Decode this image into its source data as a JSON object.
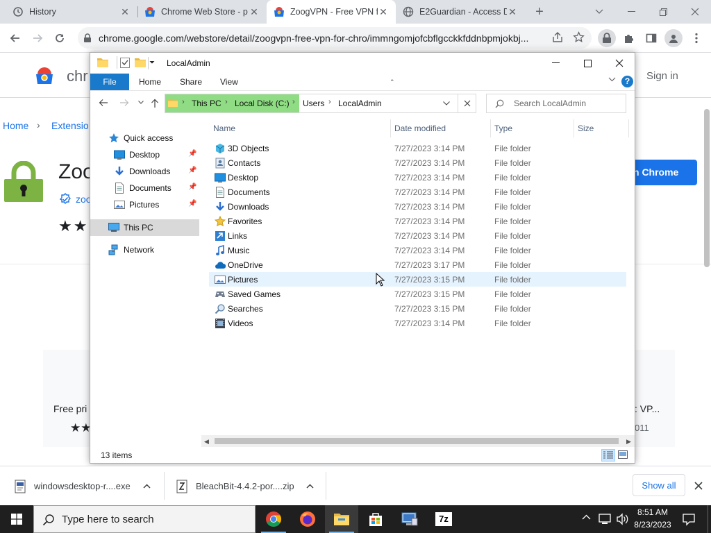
{
  "browser": {
    "tabs": [
      {
        "title": "History",
        "active": false
      },
      {
        "title": "Chrome Web Store - p",
        "active": false
      },
      {
        "title": "ZoogVPN - Free VPN f",
        "active": true
      },
      {
        "title": "E2Guardian - Access D",
        "active": false
      }
    ],
    "url": "chrome.google.com/webstore/detail/zoogvpn-free-vpn-for-chro/immngomjofcbflgcckkfddnbpmjokbj..."
  },
  "webpage": {
    "store_name": "chr",
    "sign_in": "Sign in",
    "breadcrumb_home": "Home",
    "breadcrumb_ext": "Extensio",
    "ext_title": "Zoo",
    "publisher": "zoo",
    "add_button": "n Chrome",
    "card_left_title": "Free pri",
    "card_right_title": ": VP...",
    "card_right_meta": "011",
    "colors": {
      "brand_blue": "#1a73e8",
      "lock_green": "#7cb342"
    }
  },
  "explorer": {
    "window_title": "LocalAdmin",
    "ribbon_tabs": [
      "File",
      "Home",
      "Share",
      "View"
    ],
    "breadcrumb": [
      "This PC",
      "Local Disk (C:)",
      "Users",
      "LocalAdmin"
    ],
    "search_placeholder": "Search LocalAdmin",
    "nav": {
      "quick_access": "Quick access",
      "pinned": [
        "Desktop",
        "Downloads",
        "Documents",
        "Pictures"
      ],
      "this_pc": "This PC",
      "network": "Network"
    },
    "columns": {
      "name": "Name",
      "date": "Date modified",
      "type": "Type",
      "size": "Size"
    },
    "files": [
      {
        "name": "3D Objects",
        "date": "7/27/2023 3:14 PM",
        "type": "File folder",
        "icon": "3d-objects-icon"
      },
      {
        "name": "Contacts",
        "date": "7/27/2023 3:14 PM",
        "type": "File folder",
        "icon": "contacts-icon"
      },
      {
        "name": "Desktop",
        "date": "7/27/2023 3:14 PM",
        "type": "File folder",
        "icon": "desktop-icon"
      },
      {
        "name": "Documents",
        "date": "7/27/2023 3:14 PM",
        "type": "File folder",
        "icon": "documents-icon"
      },
      {
        "name": "Downloads",
        "date": "7/27/2023 3:14 PM",
        "type": "File folder",
        "icon": "downloads-icon"
      },
      {
        "name": "Favorites",
        "date": "7/27/2023 3:14 PM",
        "type": "File folder",
        "icon": "star-icon"
      },
      {
        "name": "Links",
        "date": "7/27/2023 3:14 PM",
        "type": "File folder",
        "icon": "links-icon"
      },
      {
        "name": "Music",
        "date": "7/27/2023 3:14 PM",
        "type": "File folder",
        "icon": "music-icon"
      },
      {
        "name": "OneDrive",
        "date": "7/27/2023 3:17 PM",
        "type": "File folder",
        "icon": "cloud-icon"
      },
      {
        "name": "Pictures",
        "date": "7/27/2023 3:15 PM",
        "type": "File folder",
        "icon": "pictures-icon"
      },
      {
        "name": "Saved Games",
        "date": "7/27/2023 3:15 PM",
        "type": "File folder",
        "icon": "saved-games-icon"
      },
      {
        "name": "Searches",
        "date": "7/27/2023 3:15 PM",
        "type": "File folder",
        "icon": "search-icon"
      },
      {
        "name": "Videos",
        "date": "7/27/2023 3:14 PM",
        "type": "File folder",
        "icon": "videos-icon"
      }
    ],
    "status": "13 items"
  },
  "downloads": {
    "items": [
      "windowsdesktop-r....exe",
      "BleachBit-4.4.2-por....zip"
    ],
    "show_all": "Show all"
  },
  "taskbar": {
    "search_placeholder": "Type here to search",
    "time": "8:51 AM",
    "date": "8/23/2023"
  }
}
